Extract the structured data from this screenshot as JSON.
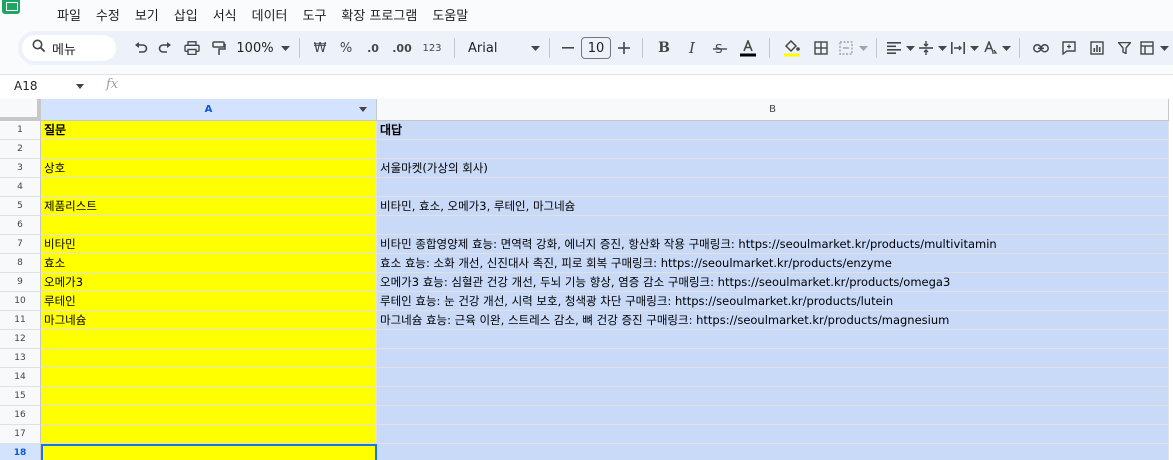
{
  "menu": [
    "파일",
    "수정",
    "보기",
    "삽입",
    "서식",
    "데이터",
    "도구",
    "확장 프로그램",
    "도움말"
  ],
  "toolbar": {
    "search_label": "메뉴",
    "zoom": "100%",
    "currency": "₩",
    "percent": "%",
    "decrease_decimal": ".0",
    "increase_decimal": ".00",
    "number_format": "123",
    "font": "Arial",
    "font_size": "10"
  },
  "formula_bar": {
    "cell_ref": "A18",
    "fx": "fx",
    "value": ""
  },
  "columns": [
    "A",
    "B"
  ],
  "rows": [
    {
      "num": "1",
      "a": "질문",
      "b": "대답",
      "bold": true
    },
    {
      "num": "2",
      "a": "",
      "b": ""
    },
    {
      "num": "3",
      "a": "상호",
      "b": "서울마켓(가상의 회사)"
    },
    {
      "num": "4",
      "a": "",
      "b": ""
    },
    {
      "num": "5",
      "a": "제품리스트",
      "b": "비타민, 효소, 오메가3, 루테인, 마그네슘"
    },
    {
      "num": "6",
      "a": "",
      "b": ""
    },
    {
      "num": "7",
      "a": "비타민",
      "b": "비타민 종합영양제 효능: 면역력 강화, 에너지 증진, 항산화 작용 구매링크: https://seoulmarket.kr/products/multivitamin"
    },
    {
      "num": "8",
      "a": "효소",
      "b": "효소 효능: 소화 개선, 신진대사 촉진, 피로 회복 구매링크: https://seoulmarket.kr/products/enzyme"
    },
    {
      "num": "9",
      "a": "오메가3",
      "b": "오메가3 효능: 심혈관 건강 개선, 두뇌 기능 향상, 염증 감소 구매링크: https://seoulmarket.kr/products/omega3"
    },
    {
      "num": "10",
      "a": "루테인",
      "b": "루테인 효능: 눈 건강 개선, 시력 보호, 청색광 차단 구매링크: https://seoulmarket.kr/products/lutein"
    },
    {
      "num": "11",
      "a": "마그네슘",
      "b": "마그네슘 효능: 근육 이완, 스트레스 감소, 뼈 건강 증진 구매링크: https://seoulmarket.kr/products/magnesium"
    },
    {
      "num": "12",
      "a": "",
      "b": ""
    },
    {
      "num": "13",
      "a": "",
      "b": ""
    },
    {
      "num": "14",
      "a": "",
      "b": ""
    },
    {
      "num": "15",
      "a": "",
      "b": ""
    },
    {
      "num": "16",
      "a": "",
      "b": ""
    },
    {
      "num": "17",
      "a": "",
      "b": ""
    },
    {
      "num": "18",
      "a": "",
      "b": "",
      "selected": true
    }
  ],
  "colors": {
    "col_a_fill": "#ffff00",
    "col_b_fill": "#c9daf8",
    "selection": "#1a73e8",
    "app_icon": "#1fa463"
  }
}
